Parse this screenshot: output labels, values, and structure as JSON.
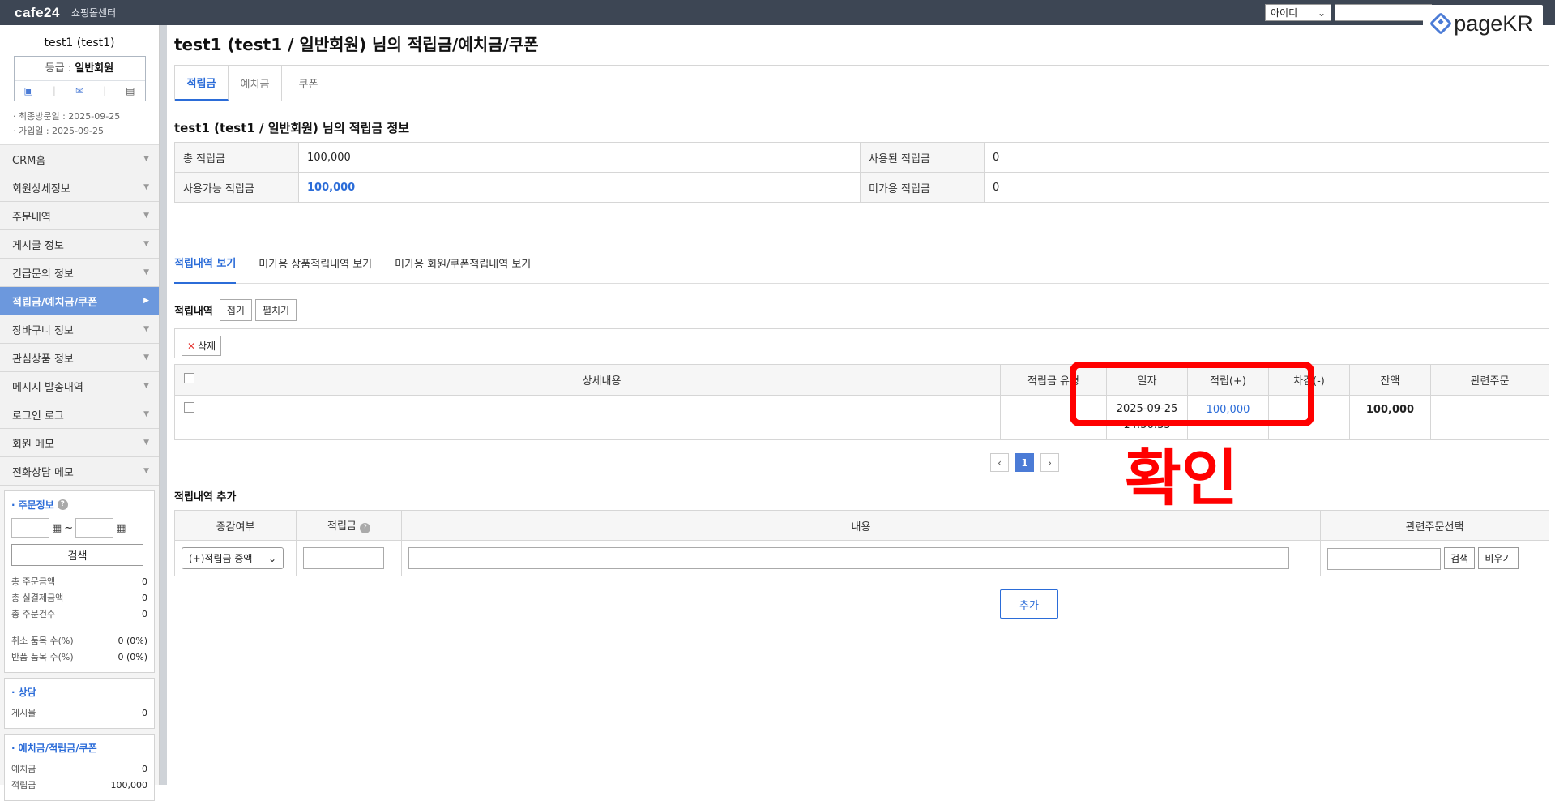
{
  "topbar": {
    "logo": "cafe24",
    "center": "쇼핑몰센터",
    "id_select": "아이디",
    "brand": "pageKR"
  },
  "sidebar": {
    "profile_name": "test1 (test1)",
    "grade_label": "등급 : ",
    "grade_value": "일반회원",
    "last_visit": "최종방문일 : 2025-09-25",
    "joined": "가입일 : 2025-09-25",
    "menu": [
      {
        "label": "CRM홈"
      },
      {
        "label": "회원상세정보"
      },
      {
        "label": "주문내역"
      },
      {
        "label": "게시글 정보"
      },
      {
        "label": "긴급문의 정보"
      },
      {
        "label": "적립금/예치금/쿠폰"
      },
      {
        "label": "장바구니 정보"
      },
      {
        "label": "관심상품 정보"
      },
      {
        "label": "메시지 발송내역"
      },
      {
        "label": "로그인 로그"
      },
      {
        "label": "회원 메모"
      },
      {
        "label": "전화상담 메모"
      }
    ],
    "order_panel": {
      "title": "주문정보",
      "search_btn": "검색",
      "rows": [
        {
          "k": "총 주문금액",
          "v": "0"
        },
        {
          "k": "총 실결제금액",
          "v": "0"
        },
        {
          "k": "총 주문건수",
          "v": "0"
        },
        {
          "k": "취소 품목 수(%)",
          "v": "0 (0%)"
        },
        {
          "k": "반품 품목 수(%)",
          "v": "0 (0%)"
        }
      ]
    },
    "consult_panel": {
      "title": "상담",
      "rows": [
        {
          "k": "게시물",
          "v": "0"
        }
      ]
    },
    "deposit_panel": {
      "title": "예치금/적립금/쿠폰",
      "rows": [
        {
          "k": "예치금",
          "v": "0"
        },
        {
          "k": "적립금",
          "v": "100,000"
        }
      ]
    }
  },
  "main": {
    "title": "test1 (test1 / 일반회원) 님의 적립금/예치금/쿠폰",
    "tabs": [
      "적립금",
      "예치금",
      "쿠폰"
    ],
    "subtitle": "test1 (test1 / 일반회원) 님의 적립금 정보",
    "info": {
      "total_label": "총 적립금",
      "total_value": "100,000",
      "used_label": "사용된 적립금",
      "used_value": "0",
      "avail_label": "사용가능 적립금",
      "avail_value": "100,000",
      "unused_label": "미가용 적립금",
      "unused_value": "0"
    },
    "subtabs": [
      "적립내역 보기",
      "미가용 상품적립내역 보기",
      "미가용 회원/쿠폰적립내역 보기"
    ],
    "history_label": "적립내역",
    "collapse_btn": "접기",
    "expand_btn": "펼치기",
    "delete_btn": "삭제",
    "hist_headers": [
      "상세내용",
      "적립금 유형",
      "일자",
      "적립(+)",
      "차감(-)",
      "잔액",
      "관련주문"
    ],
    "hist_row": {
      "date": "2025-09-25",
      "time": "14:56:35",
      "plus": "100,000",
      "minus": "",
      "balance": "100,000"
    },
    "page_current": "1",
    "annotation": "확인",
    "add_title": "적립내역 추가",
    "add_headers": [
      "증감여부",
      "적립금",
      "내용",
      "관련주문선택"
    ],
    "add_select": "(+)적립금 증액",
    "add_search_btn": "검색",
    "add_clear_btn": "비우기",
    "add_btn": "추가"
  }
}
